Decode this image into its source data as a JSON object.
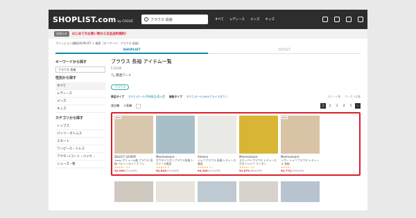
{
  "header": {
    "logo": "SHOPLIST.com",
    "logo_sub": "by CROOZ",
    "search_value": "ブラウス 長袖",
    "nav": [
      "すべて",
      "レディース",
      "メンズ",
      "キッズ"
    ]
  },
  "promo": {
    "badge": "お知らせ",
    "text": "はじめてのお買い物なら全品送料無料!"
  },
  "breadcrumb": "ファッション通販SHOPLIST > 検索（キーワード：ブラウス 長袖）",
  "tabs": [
    "SHOPLIST",
    "OUTLET"
  ],
  "sidebar": {
    "keyword_title": "キーワードから探す",
    "keyword_value": "ブラウス 長袖",
    "gender_title": "性別から探す",
    "genders": [
      "すべて",
      "レディース",
      "メンズ",
      "キッズ"
    ],
    "category_title": "カテゴリから探す",
    "categories": [
      "トップス",
      "パンツ・ボトムス",
      "スカート",
      "ワンピース・ドレス",
      "アウター(コート・ジャケ...",
      "シューズ・靴"
    ]
  },
  "main": {
    "title": "ブラウス 長袖 アイテム一覧",
    "count": "5,112件",
    "related_label": "関連ワード",
    "related_chip": "ブラウス",
    "filter_product_label": "商品タイプ",
    "filter_product_value": "すべて/セール/予約商品/再入荷",
    "filter_price_label": "価格タイプ",
    "filter_price_value": "すべて/セール/MAXプライスダウン",
    "opt1": "スピード便",
    "opt2": "クーポン対象",
    "sort_label": "並び順",
    "sort_value": "人気順",
    "pages": [
      "1",
      "2",
      "3",
      "4",
      "5",
      "›"
    ]
  },
  "products": [
    {
      "brand": "SELECT LEVERY",
      "title": "2way ボリューム袖 ブラウス 長袖 バルーンスリーブ バッ",
      "rating": "★★★★☆ 4.4",
      "price": "¥2,990",
      "off": "(71%OFF)",
      "tag": "NEW",
      "color": "#d9c7ad"
    },
    {
      "brand": "Monmaissare",
      "title": "ボウタイリボンブラウス長袖 レディース春夏",
      "rating": "★★★★★ 5",
      "price": "¥2,845",
      "off": "(21%OFF)",
      "tag": "",
      "color": "#a9bfc8"
    },
    {
      "brand": "Aimeon",
      "title": "シャツブラウス 長袖 レディース 春夏",
      "rating": "★★★★★ 4.7",
      "price": "¥4,289",
      "off": "(21%OFF)",
      "tag": "",
      "color": "#e9e9e6"
    },
    {
      "brand": "Monmaissare",
      "title": "スキッパーブラウス レディース ボタンシャツ ランタン",
      "rating": "★★★★☆ 4.3",
      "price": "¥1,879",
      "off": "(38%OFF)",
      "tag": "",
      "color": "#d9b535"
    },
    {
      "brand": "Monmaissare",
      "title": "シアー シャツブラウス レディース 長袖",
      "rating": "★★★★☆",
      "price": "¥2,774",
      "off": "(25%OFF)",
      "tag": "NEW",
      "color": "#d9c3a5"
    }
  ],
  "next_row_colors": [
    "#cfc9c0",
    "#e8e4dc",
    "#bfc9d1",
    "#d7d3cc",
    "#b8c3cf"
  ]
}
